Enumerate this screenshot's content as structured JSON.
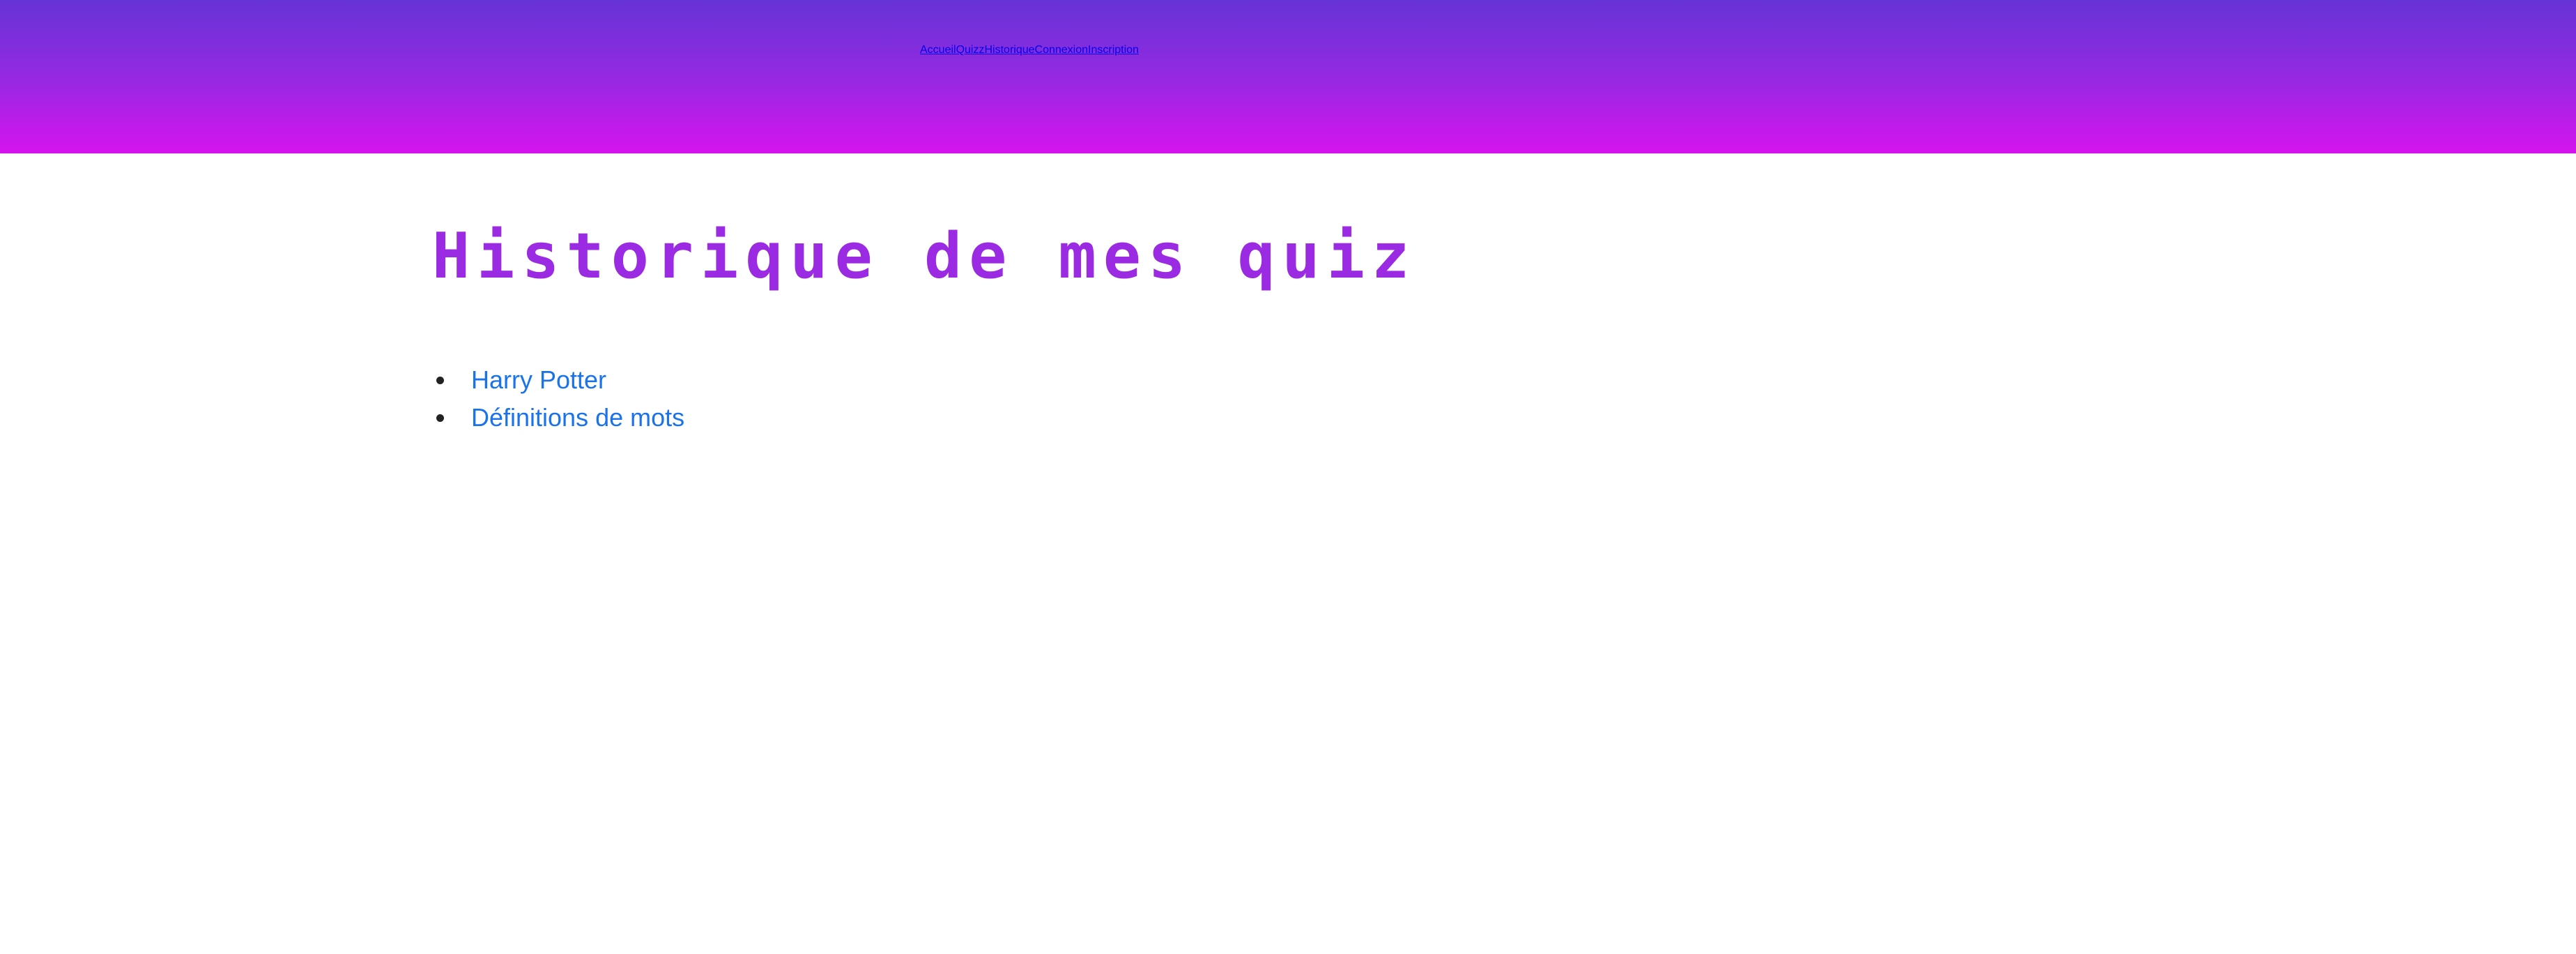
{
  "header": {
    "nav": [
      {
        "label": "Accueil"
      },
      {
        "label": "Quizz"
      },
      {
        "label": "Historique"
      },
      {
        "label": "Connexion"
      },
      {
        "label": "Inscription"
      }
    ]
  },
  "main": {
    "title": "Historique de mes quiz",
    "quizzes": [
      {
        "label": "Harry Potter"
      },
      {
        "label": "Définitions de mots"
      }
    ]
  },
  "colors": {
    "header_gradient_top": "#6633d6",
    "header_gradient_bottom": "#d514ee",
    "title": "#9b2be2",
    "link": "#1a73e8"
  }
}
